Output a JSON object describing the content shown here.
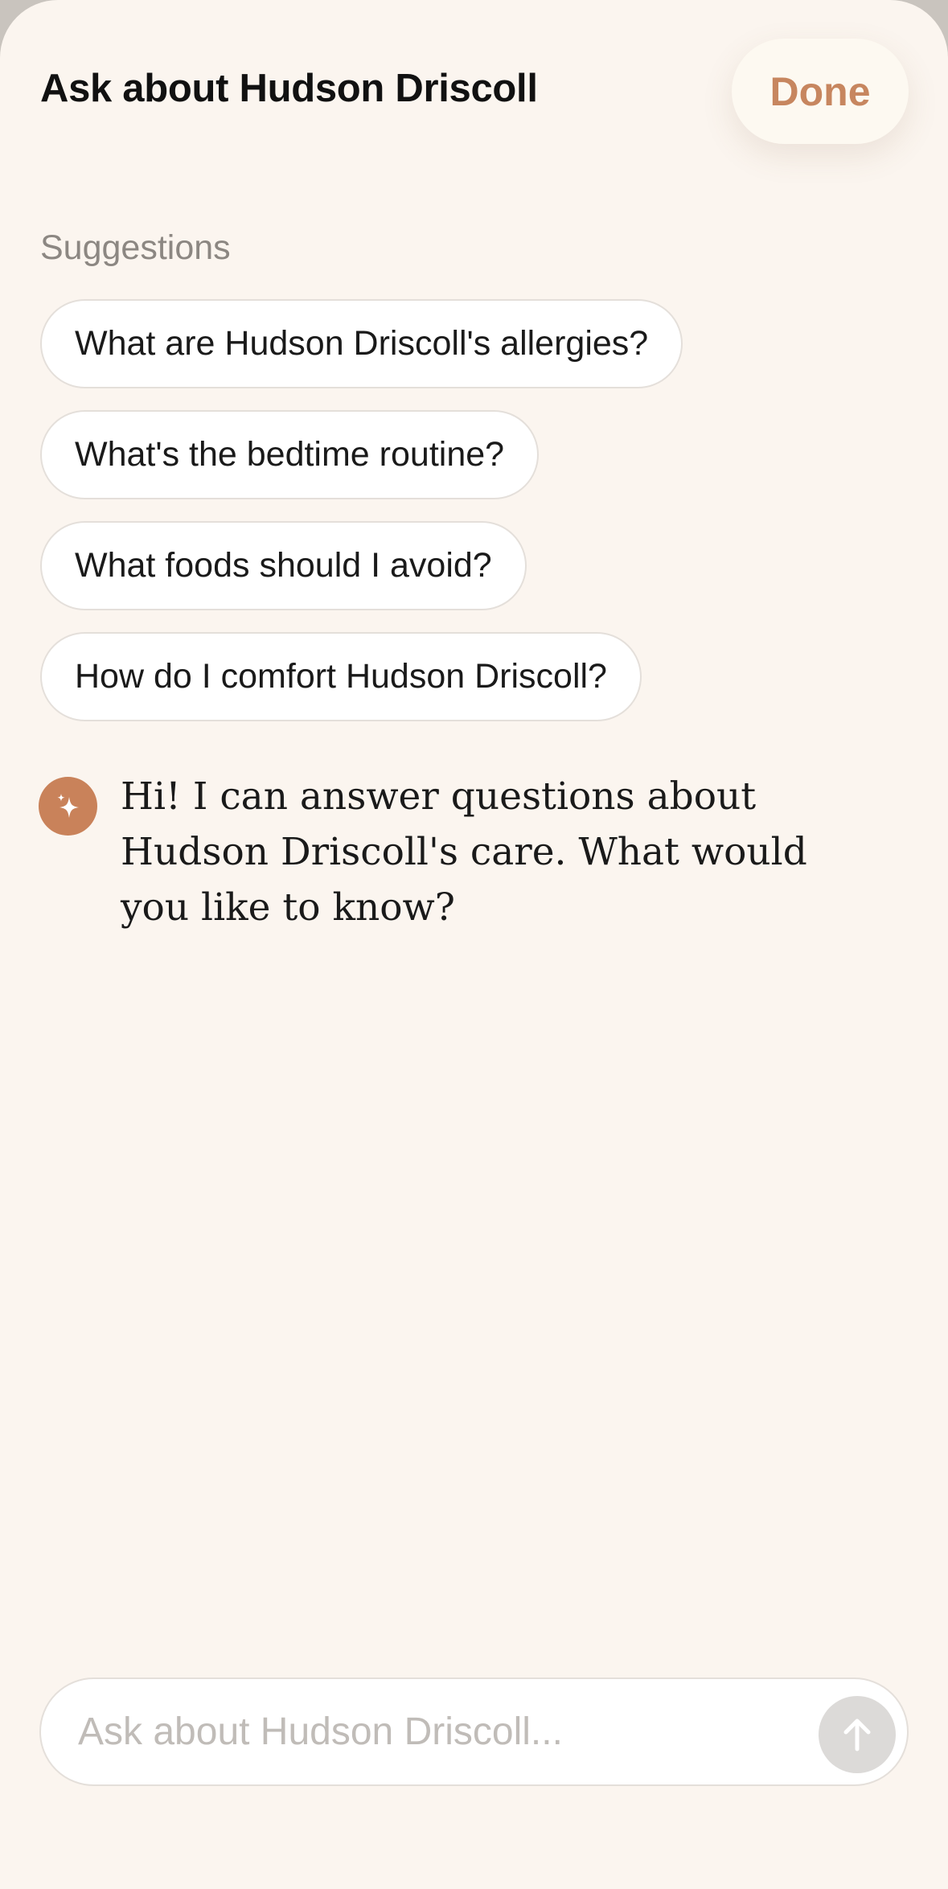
{
  "header": {
    "title": "Ask about Hudson Driscoll",
    "done_label": "Done"
  },
  "suggestions": {
    "label": "Suggestions",
    "items": [
      "What are Hudson Driscoll's allergies?",
      "What's the bedtime routine?",
      "What foods should I avoid?",
      "How do I comfort Hudson Driscoll?"
    ]
  },
  "conversation": {
    "assistant_icon": "sparkle-icon",
    "assistant_message": "Hi! I can answer questions about Hudson Driscoll's care. What would you like to know?"
  },
  "composer": {
    "placeholder": "Ask about Hudson Driscoll...",
    "value": "",
    "send_icon": "arrow-up-icon"
  },
  "colors": {
    "accent": "#c7865f",
    "background": "#fbf5ef",
    "avatar": "#c9825a"
  }
}
